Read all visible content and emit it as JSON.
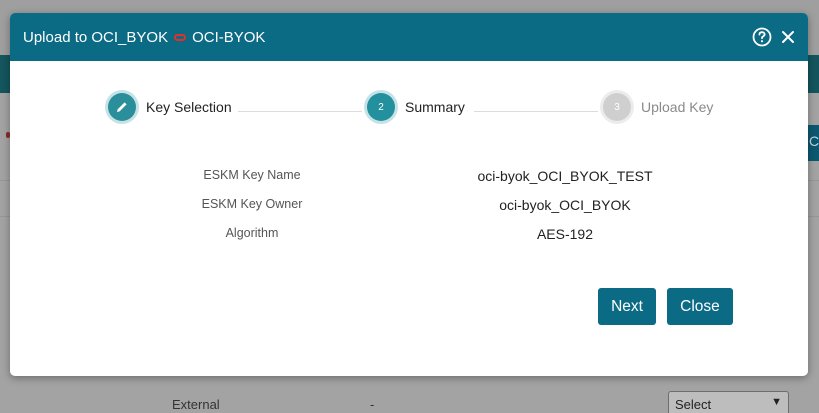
{
  "background": {
    "tab_partial": "C",
    "row_label": "External",
    "row_value": "-",
    "select_value": "Select"
  },
  "modal": {
    "title_prefix": "Upload to OCI_BYOK",
    "title_target": "OCI-BYOK",
    "help_icon": "question-circle-icon",
    "close_icon": "x-icon"
  },
  "stepper": {
    "steps": [
      {
        "number": "",
        "label": "Key Selection",
        "state": "done",
        "icon": "pencil-icon"
      },
      {
        "number": "2",
        "label": "Summary",
        "state": "active"
      },
      {
        "number": "3",
        "label": "Upload Key",
        "state": "pending"
      }
    ]
  },
  "summary": {
    "rows": [
      {
        "label": "ESKM Key Name",
        "value": "oci-byok_OCI_BYOK_TEST"
      },
      {
        "label": "ESKM Key Owner",
        "value": "oci-byok_OCI_BYOK"
      },
      {
        "label": "Algorithm",
        "value": "AES-192"
      }
    ]
  },
  "buttons": {
    "next": "Next",
    "close": "Close"
  },
  "colors": {
    "primary": "#0b6a84",
    "step_active": "#23909d",
    "step_pending": "#cfcfcf",
    "oci_red": "#e0312b"
  }
}
